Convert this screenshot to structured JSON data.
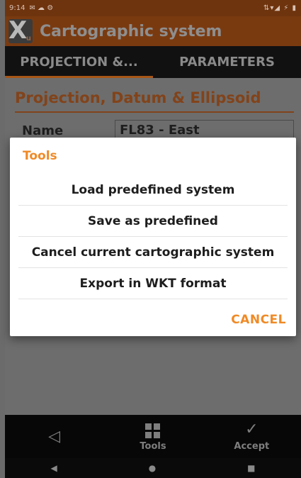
{
  "status_bar": {
    "time": "9:14",
    "left_icons": "✉ ☁ ⚙",
    "right_icons": "⇅▾◢ ⚡ ▮"
  },
  "app_bar": {
    "logo_letter": "X",
    "logo_sub": "u",
    "title": "Cartographic system"
  },
  "tabs": [
    {
      "label": "PROJECTION &...",
      "active": true
    },
    {
      "label": "PARAMETERS",
      "active": false
    }
  ],
  "content": {
    "section_title": "Projection, Datum & Ellipsoid",
    "name_label": "Name",
    "name_value": "FL83 - East"
  },
  "dialog": {
    "title": "Tools",
    "items": [
      {
        "label": "Load predefined system"
      },
      {
        "label": "Save as predefined"
      },
      {
        "label": "Cancel current cartographic system"
      },
      {
        "label": "Export in WKT format"
      }
    ],
    "cancel_label": "CANCEL"
  },
  "toolbar": {
    "back_glyph": "◁",
    "tools_label": "Tools",
    "accept_glyph": "✓",
    "accept_label": "Accept"
  },
  "nav_bar": {
    "back": "◀",
    "home": "●",
    "recents": "■"
  },
  "colors": {
    "accent": "#f08a26",
    "app_bar": "#7a3a10",
    "tab_bar": "#111111"
  }
}
